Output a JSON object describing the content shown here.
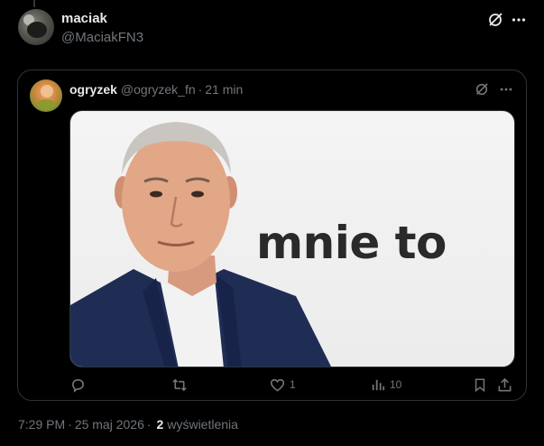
{
  "post": {
    "author_name": "maciak",
    "author_handle": "@MaciakFN3",
    "time": "7:29 PM",
    "date": "25 maj 2026",
    "views_count": "2",
    "views_label": "wyświetlenia"
  },
  "quoted": {
    "author_name": "ogryzek",
    "author_handle": "@ogryzek_fn",
    "time": "21 min",
    "media_caption": "mnie to",
    "actions": {
      "like_count": "1",
      "views_count": "10"
    }
  },
  "icons": {
    "grok": "grok-icon",
    "more": "more-icon",
    "reply": "reply-icon",
    "retweet": "retweet-icon",
    "like": "heart-icon",
    "views": "views-icon",
    "bookmark": "bookmark-icon",
    "share": "share-icon"
  },
  "colors": {
    "background": "#000000",
    "text": "#e7e9ea",
    "muted": "#71767b",
    "border": "#2f3336"
  }
}
